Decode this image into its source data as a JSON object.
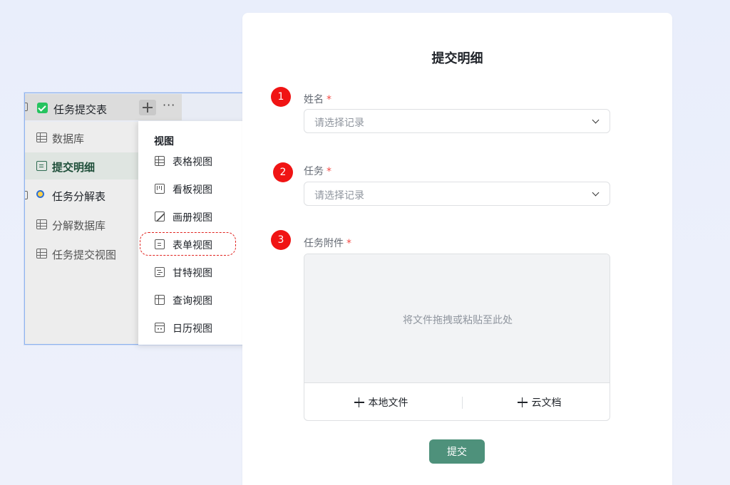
{
  "sidebar": {
    "header_title": "任务提交表",
    "items": [
      {
        "label": "数据库"
      },
      {
        "label": "提交明细"
      },
      {
        "label": "任务分解表"
      },
      {
        "label": "分解数据库"
      },
      {
        "label": "任务提交视图"
      }
    ],
    "more_label": "···"
  },
  "view_menu": {
    "title": "视图",
    "items": [
      {
        "label": "表格视图"
      },
      {
        "label": "看板视图"
      },
      {
        "label": "画册视图"
      },
      {
        "label": "表单视图"
      },
      {
        "label": "甘特视图"
      },
      {
        "label": "查询视图"
      },
      {
        "label": "日历视图"
      }
    ]
  },
  "form": {
    "title": "提交明细",
    "fields": [
      {
        "step": "1",
        "label": "姓名",
        "required": "*",
        "placeholder": "请选择记录"
      },
      {
        "step": "2",
        "label": "任务",
        "required": "*",
        "placeholder": "请选择记录"
      },
      {
        "step": "3",
        "label": "任务附件",
        "required": "*"
      }
    ],
    "upload": {
      "drop_text": "将文件拖拽或粘贴至此处",
      "local_file": "本地文件",
      "cloud_doc": "云文档"
    },
    "submit_label": "提交"
  },
  "colors": {
    "submit": "#4e917b",
    "badge": "#f01414",
    "highlight": "#e0231f",
    "checkbox": "#26c35f"
  }
}
